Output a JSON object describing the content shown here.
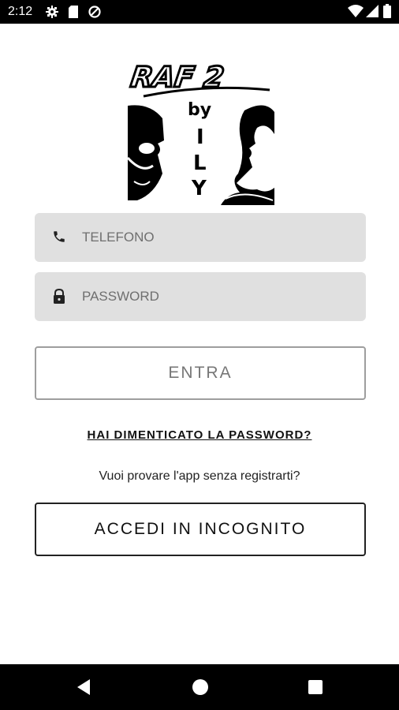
{
  "status_bar": {
    "time": "2:12",
    "left_icons": [
      "gear-icon",
      "sd-card-icon",
      "do-not-disturb-icon"
    ],
    "right_icons": [
      "wifi-icon",
      "cell-signal-icon",
      "battery-icon"
    ]
  },
  "logo": {
    "text_line_1": "RAF 2",
    "text_line_2": "by",
    "text_letters": [
      "I",
      "L",
      "Y"
    ]
  },
  "login_form": {
    "phone_placeholder": "TELEFONO",
    "phone_icon": "phone-icon",
    "password_placeholder": "PASSWORD",
    "password_icon": "lock-icon",
    "submit_label": "ENTRA"
  },
  "forgot_password_link": "HAI DIMENTICATO LA PASSWORD?",
  "guest_prompt": "Vuoi provare l'app senza registrarti?",
  "guest_button_label": "ACCEDI IN INCOGNITO",
  "nav_bar": {
    "icons": [
      "back-icon",
      "home-icon",
      "recents-icon"
    ]
  }
}
